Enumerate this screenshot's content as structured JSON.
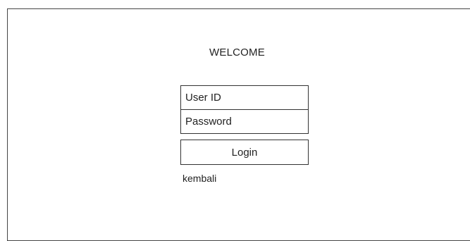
{
  "page": {
    "title": "WELCOME"
  },
  "form": {
    "user_id_placeholder": "User ID",
    "password_placeholder": "Password",
    "login_label": "Login",
    "back_label": "kembali"
  }
}
